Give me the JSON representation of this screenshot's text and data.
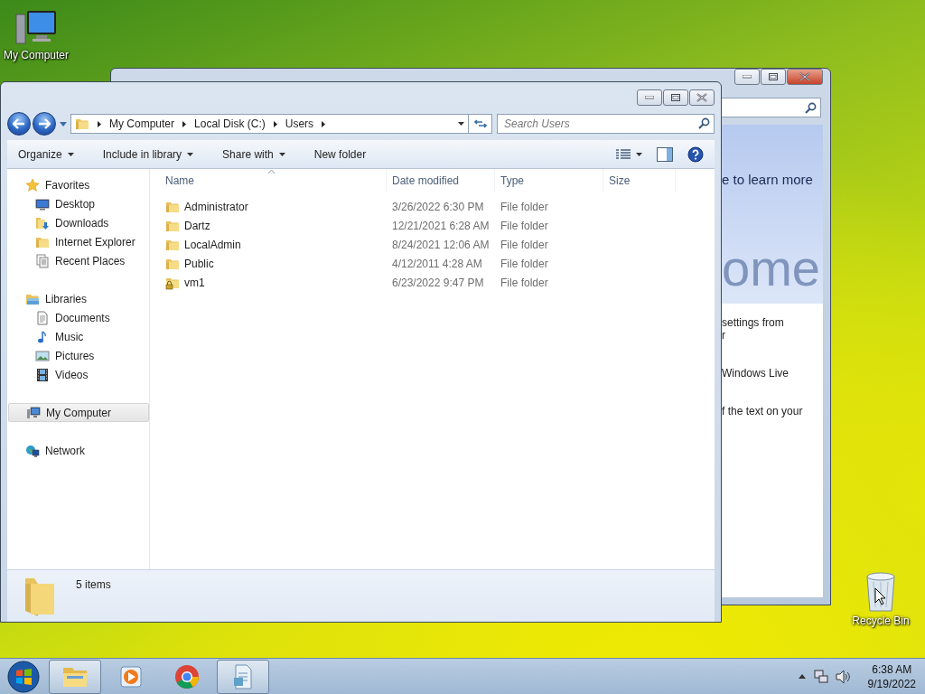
{
  "desktop_icons": [
    {
      "label": "My Computer",
      "kind": "computer"
    },
    {
      "label": "Recycle Bin",
      "kind": "recycle"
    }
  ],
  "background_window": {
    "link_text": "e to learn more",
    "banner_text": "ome",
    "lines": [
      "settings from",
      "r",
      "Windows Live",
      "f the text on your"
    ]
  },
  "explorer": {
    "address": [
      "My Computer",
      "Local Disk (C:)",
      "Users"
    ],
    "search": {
      "placeholder": "Search Users"
    },
    "toolbar": [
      {
        "label": "Organize",
        "dropdown": true
      },
      {
        "label": "Include in library",
        "dropdown": true
      },
      {
        "label": "Share with",
        "dropdown": true
      },
      {
        "label": "New folder",
        "dropdown": false
      }
    ],
    "nav": [
      {
        "label": "Favorites",
        "kind": "star",
        "selected": false,
        "children": [
          {
            "label": "Desktop",
            "kind": "desktop",
            "selected": false
          },
          {
            "label": "Downloads",
            "kind": "downloads",
            "selected": false
          },
          {
            "label": "Internet Explorer",
            "kind": "folder",
            "selected": false
          },
          {
            "label": "Recent Places",
            "kind": "recent",
            "selected": false
          }
        ]
      },
      {
        "label": "Libraries",
        "kind": "libraries",
        "selected": false,
        "children": [
          {
            "label": "Documents",
            "kind": "documents",
            "selected": false
          },
          {
            "label": "Music",
            "kind": "music",
            "selected": false
          },
          {
            "label": "Pictures",
            "kind": "pictures",
            "selected": false
          },
          {
            "label": "Videos",
            "kind": "videos",
            "selected": false
          }
        ]
      },
      {
        "label": "My Computer",
        "kind": "computer",
        "selected": true
      },
      {
        "label": "Network",
        "kind": "network",
        "selected": false
      }
    ],
    "columns": [
      {
        "label": "Name",
        "sorted": true
      },
      {
        "label": "Date modified",
        "sorted": false
      },
      {
        "label": "Type",
        "sorted": false
      },
      {
        "label": "Size",
        "sorted": false
      }
    ],
    "rows": [
      {
        "name": "Administrator",
        "date": "3/26/2022 6:30 PM",
        "type": "File folder",
        "locked": false
      },
      {
        "name": "Dartz",
        "date": "12/21/2021 6:28 AM",
        "type": "File folder",
        "locked": false
      },
      {
        "name": "LocalAdmin",
        "date": "8/24/2021 12:06 AM",
        "type": "File folder",
        "locked": false
      },
      {
        "name": "Public",
        "date": "4/12/2011 4:28 AM",
        "type": "File folder",
        "locked": false
      },
      {
        "name": "vm1",
        "date": "6/23/2022 9:47 PM",
        "type": "File folder",
        "locked": true
      }
    ],
    "status": "5 items"
  },
  "taskbar": {
    "apps": [
      {
        "kind": "explorer",
        "active": true
      },
      {
        "kind": "media",
        "active": false
      },
      {
        "kind": "browser",
        "active": false
      },
      {
        "kind": "document",
        "active": true
      }
    ],
    "time": "6:38 AM",
    "date": "9/19/2022"
  }
}
